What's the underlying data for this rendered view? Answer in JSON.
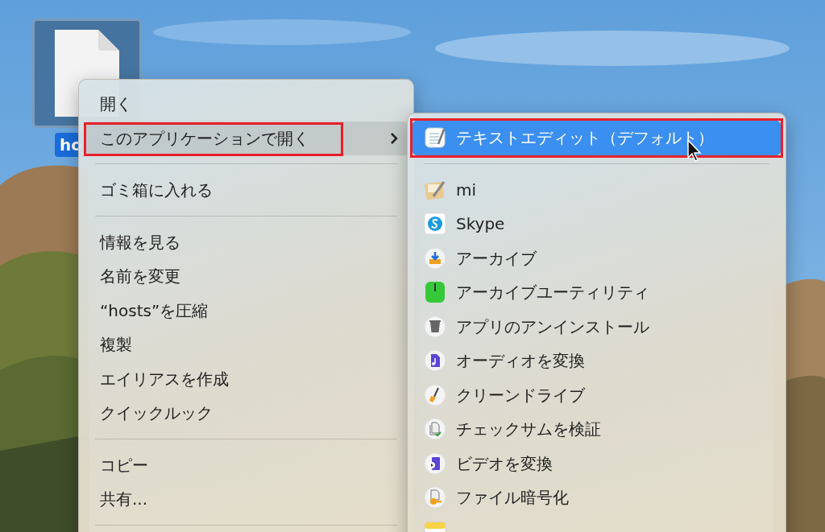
{
  "desktop": {
    "kind": "picture",
    "file": {
      "label": "ho",
      "selected": true
    }
  },
  "context_menu": {
    "items": [
      {
        "kind": "item",
        "label": "開く",
        "selected": false,
        "highlighted": false,
        "submenu": false
      },
      {
        "kind": "item",
        "label": "このアプリケーションで開く",
        "selected": true,
        "highlighted": true,
        "submenu": true
      },
      {
        "kind": "separator"
      },
      {
        "kind": "item",
        "label": "ゴミ箱に入れる",
        "selected": false,
        "highlighted": false,
        "submenu": false
      },
      {
        "kind": "separator"
      },
      {
        "kind": "item",
        "label": "情報を見る",
        "selected": false,
        "highlighted": false,
        "submenu": false
      },
      {
        "kind": "item",
        "label": "名前を変更",
        "selected": false,
        "highlighted": false,
        "submenu": false
      },
      {
        "kind": "item",
        "label": "“hosts”を圧縮",
        "selected": false,
        "highlighted": false,
        "submenu": false
      },
      {
        "kind": "item",
        "label": "複製",
        "selected": false,
        "highlighted": false,
        "submenu": false
      },
      {
        "kind": "item",
        "label": "エイリアスを作成",
        "selected": false,
        "highlighted": false,
        "submenu": false
      },
      {
        "kind": "item",
        "label": "クイックルック",
        "selected": false,
        "highlighted": false,
        "submenu": false
      },
      {
        "kind": "separator"
      },
      {
        "kind": "item",
        "label": "コピー",
        "selected": false,
        "highlighted": false,
        "submenu": false
      },
      {
        "kind": "item",
        "label": "共有...",
        "selected": false,
        "highlighted": false,
        "submenu": false
      },
      {
        "kind": "separator"
      }
    ]
  },
  "submenu": {
    "items": [
      {
        "kind": "item",
        "label": "テキストエディット（デフォルト）",
        "selected": true,
        "highlighted": true
      },
      {
        "kind": "separator"
      },
      {
        "kind": "item",
        "label": "mi",
        "selected": false,
        "highlighted": false
      },
      {
        "kind": "item",
        "label": "Skype",
        "selected": false,
        "highlighted": false
      },
      {
        "kind": "item",
        "label": "アーカイブ",
        "selected": false,
        "highlighted": false
      },
      {
        "kind": "item",
        "label": "アーカイブユーティリティ",
        "selected": false,
        "highlighted": false
      },
      {
        "kind": "item",
        "label": "アプリのアンインストール",
        "selected": false,
        "highlighted": false
      },
      {
        "kind": "item",
        "label": "オーディオを変換",
        "selected": false,
        "highlighted": false
      },
      {
        "kind": "item",
        "label": "クリーンドライブ",
        "selected": false,
        "highlighted": false
      },
      {
        "kind": "item",
        "label": "チェックサムを検証",
        "selected": false,
        "highlighted": false
      },
      {
        "kind": "item",
        "label": "ビデオを変換",
        "selected": false,
        "highlighted": false
      },
      {
        "kind": "item",
        "label": "ファイル暗号化",
        "selected": false,
        "highlighted": false
      },
      {
        "kind": "item",
        "selected": false,
        "highlighted": false
      }
    ]
  }
}
